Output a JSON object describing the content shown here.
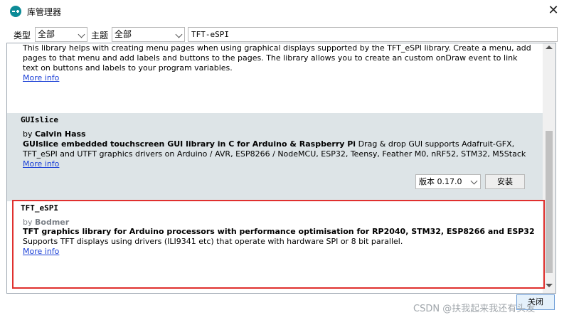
{
  "window": {
    "title": "库管理器",
    "close_symbol": "✕"
  },
  "filters": {
    "type_label": "类型",
    "type_value": "全部",
    "topic_label": "主题",
    "topic_value": "全部",
    "search_value": "TFT-eSPI"
  },
  "libraries": [
    {
      "description": "This library helps with creating menu pages when using graphical displays supported by the TFT_eSPI library. Create a menu, add pages to that menu and add labels and buttons to the pages. The library allows you to create an custom onDraw event to link text on buttons and labels to your program variables.",
      "more_info": "More info"
    },
    {
      "name": "GUIslice",
      "author_prefix": "by ",
      "author": "Calvin Hass",
      "summary": "GUIslice embedded touchscreen GUI library in C for Arduino & Raspberry Pi",
      "description": " Drag & drop GUI supports Adafruit-GFX, TFT_eSPI and UTFT graphics drivers on Arduino / AVR, ESP8266 / NodeMCU, ESP32, Teensy, Feather M0, nRF52, STM32, M5Stack",
      "more_info": "More info",
      "version_label": "版本 0.17.0",
      "install_label": "安装"
    },
    {
      "name": "TFT_eSPI",
      "author_prefix": "by ",
      "author": "Bodmer",
      "summary": "TFT graphics library for Arduino processors with performance optimisation for RP2040, STM32, ESP8266 and ESP32",
      "description": " Supports TFT displays using drivers (ILI9341 etc) that operate with hardware SPI or 8 bit parallel.",
      "more_info": "More info"
    }
  ],
  "footer": {
    "close_label": "关闭",
    "watermark": "CSDN @扶我起来我还有头发"
  },
  "colors": {
    "selected_row_bg": "#dde4e7",
    "link": "#1a3fd6",
    "highlight_border": "#e0302e"
  }
}
